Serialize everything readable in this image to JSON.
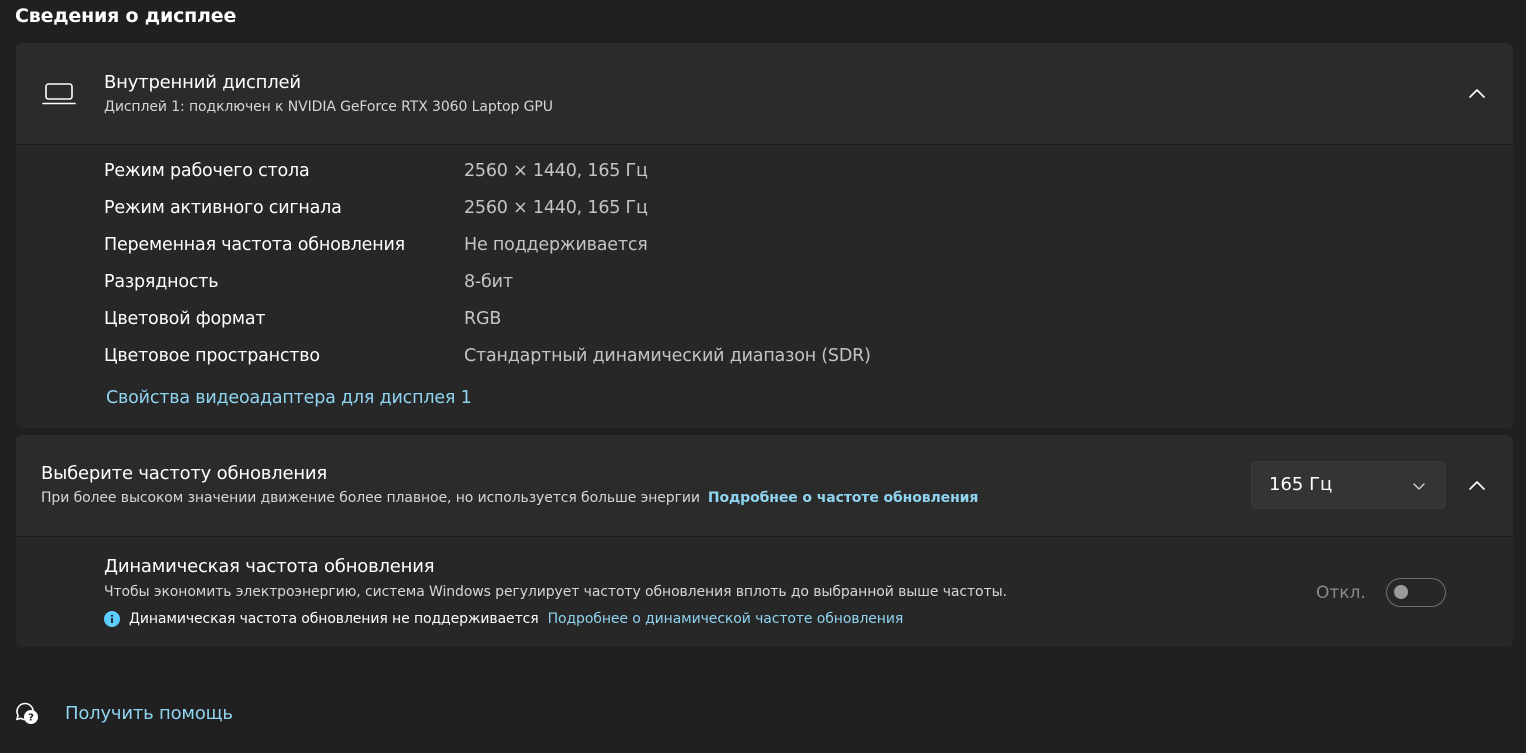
{
  "page_title": "Сведения о дисплее",
  "display": {
    "title": "Внутренний дисплей",
    "subtitle": "Дисплей 1: подключен к NVIDIA GeForce RTX 3060 Laptop GPU",
    "icon": "laptop-icon",
    "properties": [
      {
        "label": "Режим рабочего стола",
        "value": "2560 × 1440, 165 Гц"
      },
      {
        "label": "Режим активного сигнала",
        "value": "2560 × 1440, 165 Гц"
      },
      {
        "label": "Переменная частота обновления",
        "value": "Не поддерживается"
      },
      {
        "label": "Разрядность",
        "value": "8-бит"
      },
      {
        "label": "Цветовой формат",
        "value": "RGB"
      },
      {
        "label": "Цветовое пространство",
        "value": "Стандартный динамический диапазон (SDR)"
      }
    ],
    "adapter_link": "Свойства видеоадаптера для дисплея 1"
  },
  "refresh": {
    "title": "Выберите частоту обновления",
    "description": "При более высоком значении движение более плавное, но используется больше энергии",
    "learn_more": "Подробнее о частоте обновления",
    "selected_rate": "165 Гц",
    "dynamic": {
      "title": "Динамическая частота обновления",
      "description": "Чтобы экономить электроэнергию, система Windows регулирует частоту обновления вплоть до выбранной выше частоты.",
      "note": "Динамическая частота обновления не поддерживается",
      "note_link": "Подробнее о динамической частоте обновления",
      "toggle_label": "Откл.",
      "toggle_on": false
    }
  },
  "help": {
    "label": "Получить помощь",
    "icon": "help-chat-icon"
  },
  "colors": {
    "background": "#202020",
    "card": "#272727",
    "link": "#8fd4f0",
    "info_icon": "#60cdff"
  }
}
